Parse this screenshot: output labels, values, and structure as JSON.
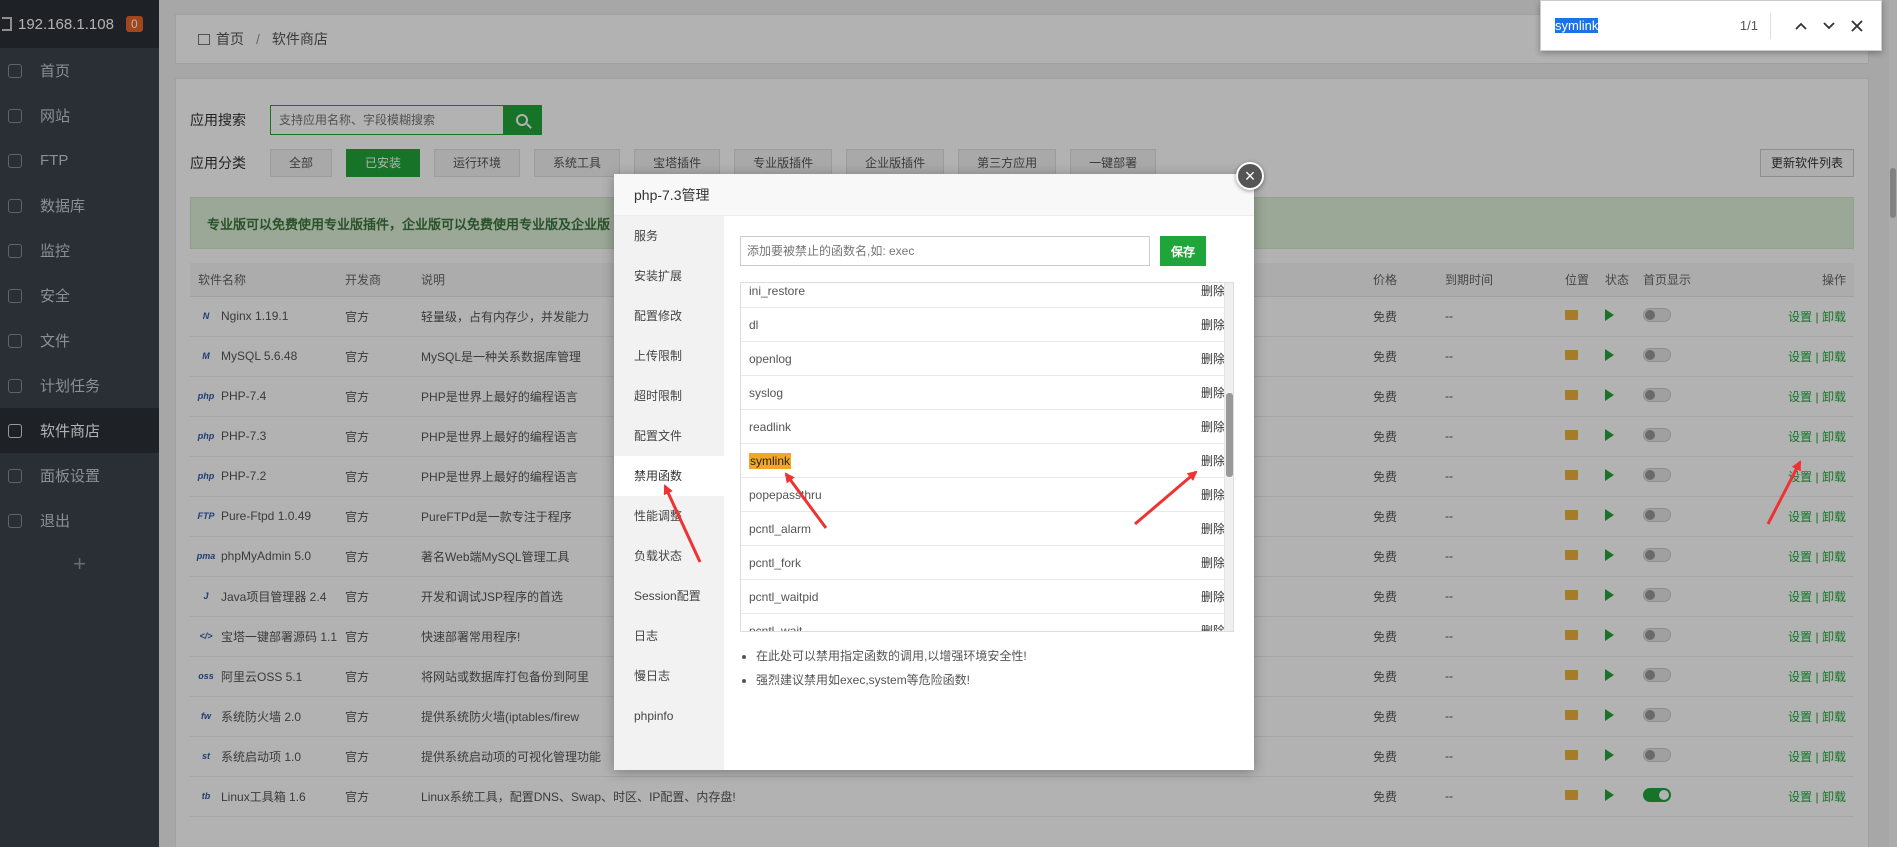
{
  "sidebar": {
    "ip": "192.168.1.108",
    "badge": "0",
    "items": [
      {
        "label": "首页",
        "name": "home"
      },
      {
        "label": "网站",
        "name": "website"
      },
      {
        "label": "FTP",
        "name": "ftp"
      },
      {
        "label": "数据库",
        "name": "database"
      },
      {
        "label": "监控",
        "name": "monitor"
      },
      {
        "label": "安全",
        "name": "security"
      },
      {
        "label": "文件",
        "name": "files"
      },
      {
        "label": "计划任务",
        "name": "cron"
      },
      {
        "label": "软件商店",
        "name": "store"
      },
      {
        "label": "面板设置",
        "name": "panel-settings"
      },
      {
        "label": "退出",
        "name": "logout"
      }
    ],
    "add": "+"
  },
  "breadcrumb": {
    "home": "首页",
    "current": "软件商店"
  },
  "search": {
    "label": "应用搜索",
    "placeholder": "支持应用名称、字段模糊搜索"
  },
  "categories": {
    "label": "应用分类",
    "items": [
      "全部",
      "已安装",
      "运行环境",
      "系统工具",
      "宝塔插件",
      "专业版插件",
      "企业版插件",
      "第三方应用",
      "一键部署"
    ],
    "refresh": "更新软件列表"
  },
  "notice": "专业版可以免费使用专业版插件，企业版可以免费使用专业版及企业版",
  "table": {
    "headers": {
      "name": "软件名称",
      "dev": "开发商",
      "desc": "说明",
      "price": "价格",
      "expire": "到期时间",
      "loc": "位置",
      "status": "状态",
      "home": "首页显示",
      "ops": "操作"
    },
    "rows": [
      {
        "name": "Nginx 1.19.1",
        "dev": "官方",
        "desc": "轻量级，占有内存少，并发能力",
        "price": "免费",
        "expire": "--",
        "icon": "N",
        "home_on": false
      },
      {
        "name": "MySQL 5.6.48",
        "dev": "官方",
        "desc": "MySQL是一种关系数据库管理",
        "price": "免费",
        "expire": "--",
        "icon": "M",
        "home_on": false
      },
      {
        "name": "PHP-7.4",
        "dev": "官方",
        "desc": "PHP是世界上最好的编程语言",
        "price": "免费",
        "expire": "--",
        "icon": "php",
        "home_on": false
      },
      {
        "name": "PHP-7.3",
        "dev": "官方",
        "desc": "PHP是世界上最好的编程语言",
        "price": "免费",
        "expire": "--",
        "icon": "php",
        "home_on": false
      },
      {
        "name": "PHP-7.2",
        "dev": "官方",
        "desc": "PHP是世界上最好的编程语言",
        "price": "免费",
        "expire": "--",
        "icon": "php",
        "home_on": false
      },
      {
        "name": "Pure-Ftpd 1.0.49",
        "dev": "官方",
        "desc": "PureFTPd是一款专注于程序",
        "price": "免费",
        "expire": "--",
        "icon": "FTP",
        "home_on": false
      },
      {
        "name": "phpMyAdmin 5.0",
        "dev": "官方",
        "desc": "著名Web端MySQL管理工具",
        "price": "免费",
        "expire": "--",
        "icon": "pma",
        "home_on": false
      },
      {
        "name": "Java项目管理器 2.4",
        "dev": "官方",
        "desc": "开发和调试JSP程序的首选",
        "price": "免费",
        "expire": "--",
        "icon": "J",
        "home_on": false
      },
      {
        "name": "宝塔一键部署源码 1.1",
        "dev": "官方",
        "desc": "快速部署常用程序!",
        "price": "免费",
        "expire": "--",
        "icon": "</>",
        "home_on": false
      },
      {
        "name": "阿里云OSS 5.1",
        "dev": "官方",
        "desc": "将网站或数据库打包备份到阿里",
        "price": "免费",
        "expire": "--",
        "icon": "oss",
        "home_on": false
      },
      {
        "name": "系统防火墙 2.0",
        "dev": "官方",
        "desc": "提供系统防火墙(iptables/firew",
        "price": "免费",
        "expire": "--",
        "icon": "fw",
        "home_on": false
      },
      {
        "name": "系统启动项 1.0",
        "dev": "官方",
        "desc": "提供系统启动项的可视化管理功能",
        "price": "免费",
        "expire": "--",
        "icon": "st",
        "home_on": false
      },
      {
        "name": "Linux工具箱 1.6",
        "dev": "官方",
        "desc": "Linux系统工具，配置DNS、Swap、时区、IP配置、内存盘!",
        "price": "免费",
        "expire": "--",
        "icon": "tb",
        "home_on": true
      }
    ],
    "ops_set": "设置",
    "ops_sep": "|",
    "ops_uninstall": "卸载"
  },
  "findbar": {
    "query": "symlink",
    "count": "1/1"
  },
  "modal": {
    "title": "php-7.3管理",
    "close": "×",
    "menu": [
      "服务",
      "安装扩展",
      "配置修改",
      "上传限制",
      "超时限制",
      "配置文件",
      "禁用函数",
      "性能调整",
      "负载状态",
      "Session配置",
      "日志",
      "慢日志",
      "phpinfo"
    ],
    "active_menu": 6,
    "input_placeholder": "添加要被禁止的函数名,如: exec",
    "save": "保存",
    "delete_label": "删除",
    "functions": [
      "ini_restore",
      "dl",
      "openlog",
      "syslog",
      "readlink",
      "symlink",
      "popepassthru",
      "pcntl_alarm",
      "pcntl_fork",
      "pcntl_waitpid",
      "pcntl_wait"
    ],
    "highlight": "symlink",
    "tips": [
      "在此处可以禁用指定函数的调用,以增强环境安全性!",
      "强烈建议禁用如exec,system等危险函数!"
    ]
  },
  "colors": {
    "accent": "#20a53a",
    "arrow": "#ee3333",
    "highlight": "#f5a623",
    "sidebar": "#3c444d"
  }
}
